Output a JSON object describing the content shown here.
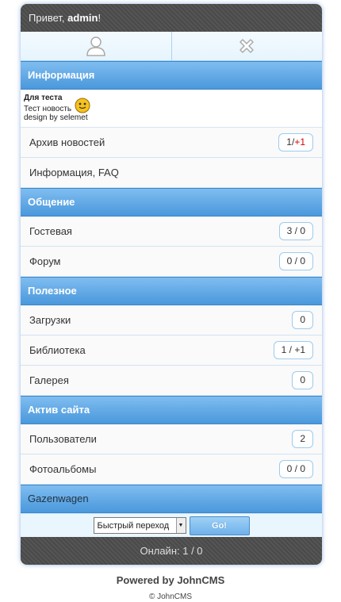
{
  "header": {
    "greeting": "Привет,",
    "username": "admin",
    "exclaim": "!"
  },
  "icons": {
    "left": "user-icon",
    "right": "close-icon"
  },
  "info": {
    "title": "Информация",
    "news": {
      "title": "Для теста",
      "line1": "Тест новость",
      "line2": "design by selemet"
    },
    "items": [
      {
        "label": "Архив новостей",
        "count": "1/",
        "new": "+1"
      },
      {
        "label": "Информация, FAQ"
      }
    ]
  },
  "communication": {
    "title": "Общение",
    "items": [
      {
        "label": "Гостевая",
        "count": "3 / 0"
      },
      {
        "label": "Форум",
        "count": "0 / 0"
      }
    ]
  },
  "useful": {
    "title": "Полезное",
    "items": [
      {
        "label": "Загрузки",
        "count": "0"
      },
      {
        "label": "Библиотека",
        "count": "1 / +1"
      },
      {
        "label": "Галерея",
        "count": "0"
      }
    ]
  },
  "active": {
    "title": "Актив сайта",
    "items": [
      {
        "label": "Пользователи",
        "count": "2"
      },
      {
        "label": "Фотоальбомы",
        "count": "0 / 0"
      }
    ]
  },
  "gazenwagen": {
    "title": "Gazenwagen"
  },
  "quick": {
    "select": "Быстрый переход",
    "go": "Go!"
  },
  "online": {
    "text": "Онлайн: 1 / 0"
  },
  "footer": {
    "powered": "Powered by JohnCMS",
    "copyright": "© JohnCMS"
  }
}
